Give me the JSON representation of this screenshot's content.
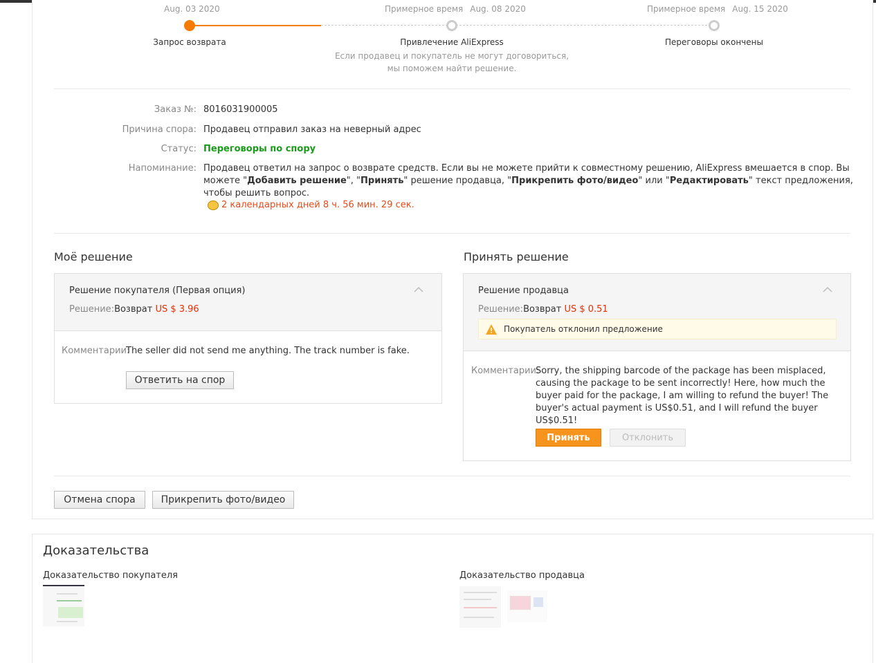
{
  "progress": {
    "steps": [
      {
        "pre": "",
        "date": "Aug. 03 2020",
        "label": "Запрос возврата",
        "sub": "",
        "state": "active"
      },
      {
        "pre": "Примерное время",
        "date": "Aug. 08 2020",
        "label": "Привлечение AliExpress",
        "sub": "Если продавец и покупатель не могут договориться, мы поможем найти решение.",
        "state": "pending"
      },
      {
        "pre": "Примерное время",
        "date": "Aug. 15 2020",
        "label": "Переговоры окончены",
        "sub": "",
        "state": "pending"
      }
    ]
  },
  "info": {
    "order_label": "Заказ №:",
    "order_value": "8016031900005",
    "reason_label": "Причина спора:",
    "reason_value": "Продавец отправил заказ на неверный адрес",
    "status_label": "Статус:",
    "status_value": "Переговоры по спору",
    "reminder_label": "Напоминание:",
    "reminder_parts": [
      "Продавец ответил на запрос о возврате средств. Если вы не можете прийти к совместному решению, AliExpress вмешается в спор. Вы можете \"",
      "Добавить решение",
      "\", \"",
      "Принять",
      "\" решение продавца, \"",
      "Прикрепить фото/видео",
      "\" или \"",
      "Редактировать",
      "\" текст предложения, чтобы решить вопрос."
    ],
    "timer": "2 календарных дней 8 ч. 56 мин. 29 сек."
  },
  "my_solution": {
    "section_title": "Моё решение",
    "card_title": "Решение покупателя (Первая опция)",
    "decision_key": "Решение:",
    "decision_type": "Возврат",
    "decision_amount": "US $ 3.96",
    "comment_key": "Комментарии:",
    "comment_value": "The seller did not send me anything. The track number is fake.",
    "reply_button": "Ответить на спор"
  },
  "accept_solution": {
    "section_title": "Принять решение",
    "card_title": "Решение продавца",
    "decision_key": "Решение:",
    "decision_type": "Возврат",
    "decision_amount": "US $ 0.51",
    "warning": "Покупатель отклонил предложение",
    "comment_key": "Комментарии:",
    "comment_value": "Sorry, the shipping barcode of the package has been misplaced, causing the package to be sent incorrectly! Here, how much the buyer paid for the package, I am willing to refund the buyer! The buyer's actual payment is US$0.51, and I will refund the buyer US$0.51!",
    "accept_button": "Принять",
    "decline_button": "Отклонить"
  },
  "actions": {
    "cancel_dispute": "Отмена спора",
    "attach_media": "Прикрепить фото/видео"
  },
  "evidence": {
    "title": "Доказательства",
    "buyer_label": "Доказательство покупателя",
    "seller_label": "Доказательство продавца"
  },
  "colors": {
    "accent": "#f7941d",
    "progress": "#f57c00",
    "price": "#e62e04",
    "status": "#1a9a1a",
    "timer": "#e64a19"
  }
}
